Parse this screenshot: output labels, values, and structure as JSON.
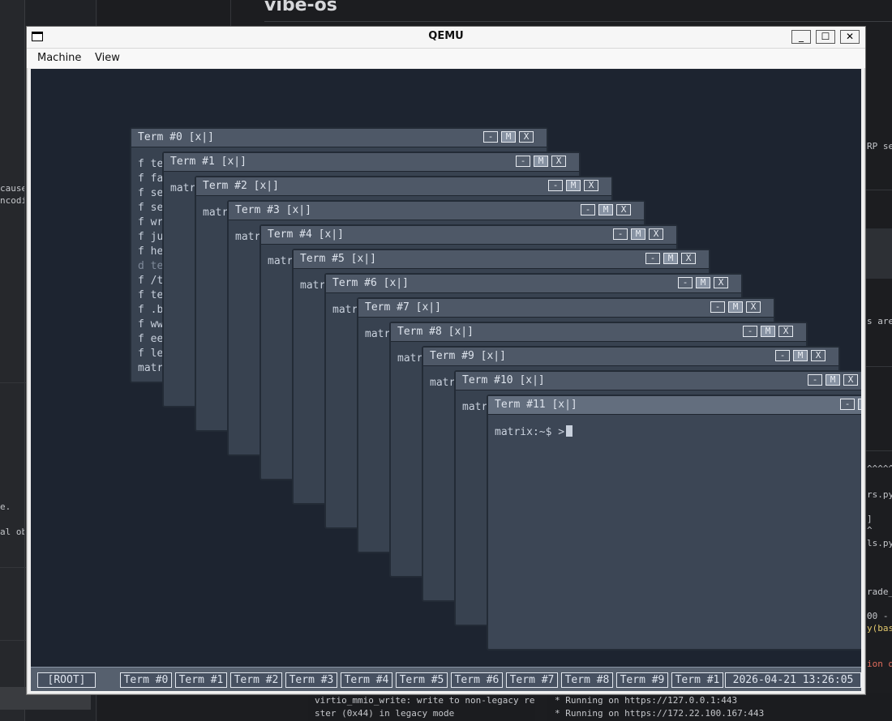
{
  "background": {
    "heading": "vibe-os",
    "left_snippets": [
      "cause",
      "ncodin",
      "e.",
      "al obj"
    ],
    "right_snippets": [
      "RP ser",
      "s are b",
      "^^^^^^",
      "rs.py\"",
      "]",
      "^",
      "ls.py",
      "rade_n",
      "00 -",
      "y(bas",
      "ion d"
    ],
    "bottom_log": [
      "virtio_mmio_write: write to non-legacy regi",
      "ster (0x44) in legacy mode"
    ],
    "bottom_server": [
      "* Running on https://127.0.0.1:443",
      "* Running on https://172.22.100.167:443"
    ]
  },
  "qemu": {
    "title": "QEMU",
    "menu": [
      "Machine",
      "View"
    ],
    "buttons": {
      "minimize": "_",
      "maximize": "☐",
      "close": "✕"
    }
  },
  "terminals": [
    {
      "title": "Term #0 [x|]",
      "lines": [
        "f te",
        "f fa",
        "f se",
        "f se",
        "f wr",
        "f ju",
        "f he",
        "d te",
        "f /t",
        "f te",
        "f .b",
        "f ww",
        "f ee",
        "f le",
        "matr"
      ]
    },
    {
      "title": "Term #1 [x|]",
      "lines": [
        "matr"
      ]
    },
    {
      "title": "Term #2 [x|]",
      "lines": [
        "matr"
      ]
    },
    {
      "title": "Term #3 [x|]",
      "lines": [
        "matr"
      ]
    },
    {
      "title": "Term #4 [x|]",
      "lines": [
        "matr"
      ]
    },
    {
      "title": "Term #5 [x|]",
      "lines": [
        "matr"
      ]
    },
    {
      "title": "Term #6 [x|]",
      "lines": [
        "matr"
      ]
    },
    {
      "title": "Term #7 [x|]",
      "lines": [
        "matr"
      ]
    },
    {
      "title": "Term #8 [x|]",
      "lines": [
        "matr"
      ]
    },
    {
      "title": "Term #9 [x|]",
      "lines": [
        "matr"
      ]
    },
    {
      "title": "Term #10 [x|]",
      "lines": [
        "matr"
      ]
    },
    {
      "title": "Term #11 [x|]",
      "lines": [
        "matrix:~$ >"
      ]
    }
  ],
  "term_buttons": {
    "min": "-",
    "max": "M",
    "close": "X"
  },
  "taskbar": {
    "root": "[ROOT]",
    "items": [
      "Term #0",
      "Term #1",
      "Term #2",
      "Term #3",
      "Term #4",
      "Term #5",
      "Term #6",
      "Term #7",
      "Term #8",
      "Term #9",
      "Term #1"
    ],
    "clock": "2026-04-21 13:26:05"
  },
  "colors": {
    "desktop": "#1d2430",
    "window_body": "#384250",
    "titlebar": "#4e5867",
    "taskbar": "#56606e",
    "text": "#c8d0dc"
  }
}
